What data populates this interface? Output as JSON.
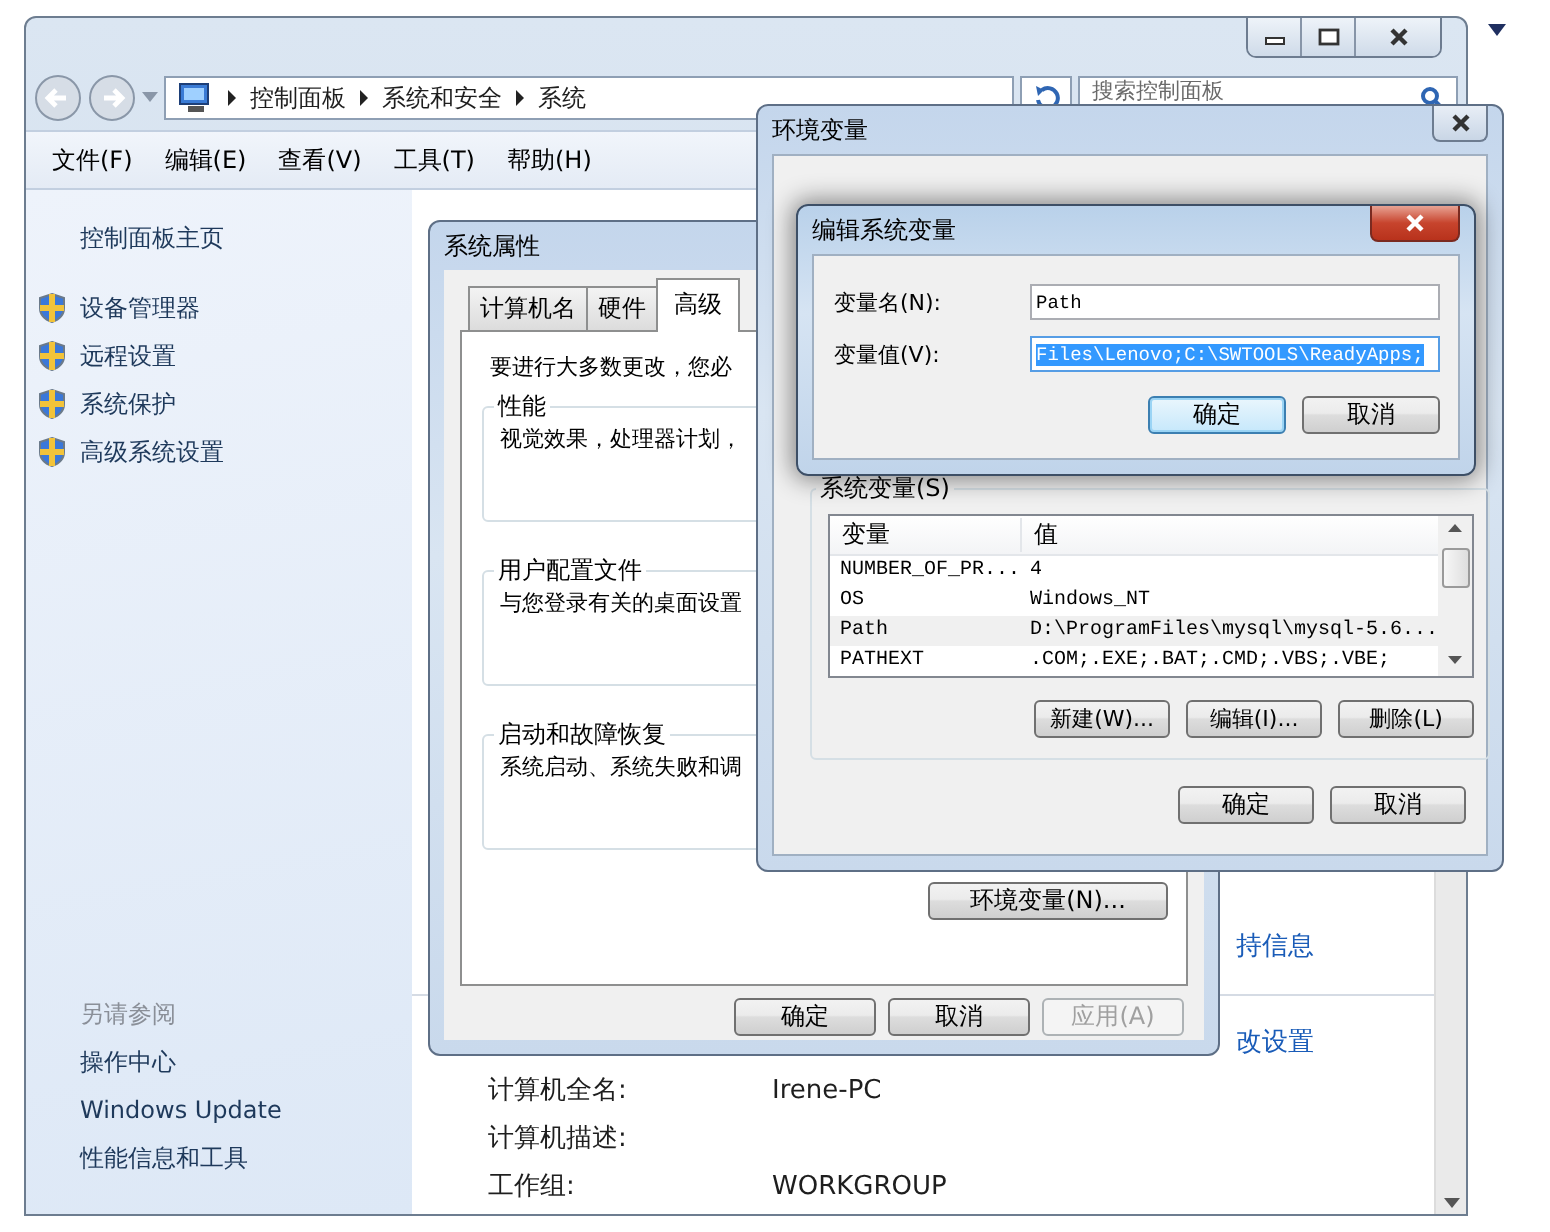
{
  "control_panel": {
    "breadcrumb": [
      "控制面板",
      "系统和安全",
      "系统"
    ],
    "search": {
      "placeholder": "搜索控制面板"
    },
    "menu": [
      "文件(F)",
      "编辑(E)",
      "查看(V)",
      "工具(T)",
      "帮助(H)"
    ],
    "sidebar": {
      "home": "控制面板主页",
      "tasks": [
        "设备管理器",
        "远程设置",
        "系统保护",
        "高级系统设置"
      ],
      "see_also_title": "另请参阅",
      "see_also": [
        "操作中心",
        "Windows Update",
        "性能信息和工具"
      ]
    },
    "links": [
      "持信息",
      "改设置"
    ],
    "details": [
      {
        "label": "计算机全名:",
        "value": "Irene-PC"
      },
      {
        "label": "计算机描述:"
      },
      {
        "label": "工作组:",
        "value": "WORKGROUP"
      }
    ]
  },
  "system_properties": {
    "title": "系统属性",
    "tabs": [
      {
        "label": "计算机名",
        "selected": false
      },
      {
        "label": "硬件",
        "selected": false
      },
      {
        "label": "高级",
        "selected": true
      }
    ],
    "intro": "要进行大多数更改，您必",
    "groups": [
      {
        "title": "性能",
        "text": "视觉效果，处理器计划，"
      },
      {
        "title": "用户配置文件",
        "text": "与您登录有关的桌面设置"
      },
      {
        "title": "启动和故障恢复",
        "text": "系统启动、系统失败和调"
      }
    ],
    "env_button": "环境变量(N)...",
    "buttons": [
      {
        "label": "确定",
        "disabled": false
      },
      {
        "label": "取消",
        "disabled": false
      },
      {
        "label": "应用(A)",
        "disabled": true
      }
    ]
  },
  "environment_variables": {
    "title": "环境变量",
    "system_vars_title": "系统变量(S)",
    "columns": [
      "变量",
      "值"
    ],
    "rows": [
      {
        "name": "NUMBER_OF_PR...",
        "value": "4",
        "selected": false
      },
      {
        "name": "OS",
        "value": "Windows_NT",
        "selected": false
      },
      {
        "name": "Path",
        "value": "D:\\ProgramFiles\\mysql\\mysql-5.6...",
        "selected": true
      },
      {
        "name": "PATHEXT",
        "value": ".COM;.EXE;.BAT;.CMD;.VBS;.VBE;",
        "selected": false
      }
    ],
    "list_buttons": [
      "新建(W)...",
      "编辑(I)...",
      "删除(L)"
    ],
    "buttons": [
      "确定",
      "取消"
    ]
  },
  "edit_dialog": {
    "title": "编辑系统变量",
    "fields": [
      {
        "label": "变量名(N):",
        "value": "Path",
        "selected": false
      },
      {
        "label": "变量值(V):",
        "value": "Files\\Lenovo;C:\\SWTOOLS\\ReadyApps;",
        "selected": true
      }
    ],
    "buttons": [
      {
        "label": "确定",
        "default": true
      },
      {
        "label": "取消",
        "default": false
      }
    ]
  }
}
